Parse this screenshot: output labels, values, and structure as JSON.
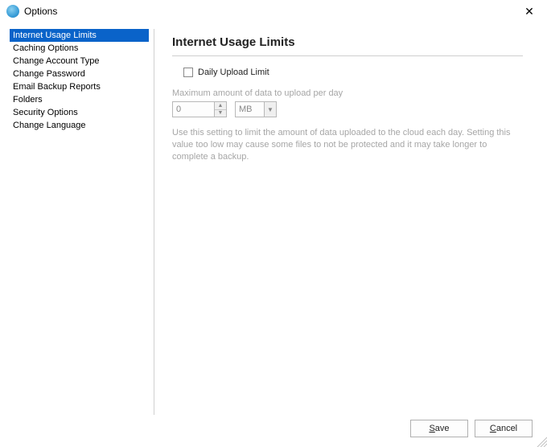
{
  "window": {
    "title": "Options",
    "close_label": "✕"
  },
  "sidebar": {
    "items": [
      {
        "label": "Internet Usage Limits",
        "selected": true
      },
      {
        "label": "Caching Options",
        "selected": false
      },
      {
        "label": "Change Account Type",
        "selected": false
      },
      {
        "label": "Change Password",
        "selected": false
      },
      {
        "label": "Email Backup Reports",
        "selected": false
      },
      {
        "label": "Folders",
        "selected": false
      },
      {
        "label": "Security Options",
        "selected": false
      },
      {
        "label": "Change Language",
        "selected": false
      }
    ]
  },
  "panel": {
    "title": "Internet Usage Limits",
    "checkbox_label": "Daily Upload Limit",
    "checkbox_checked": false,
    "section_label": "Maximum amount of data to upload per day",
    "amount_value": "0",
    "unit_value": "MB",
    "help_text": "Use this setting to limit the amount of data uploaded to the cloud each day. Setting this value too low may cause some files to not be protected and it may take longer to complete a backup."
  },
  "buttons": {
    "save": "Save",
    "cancel": "Cancel"
  }
}
